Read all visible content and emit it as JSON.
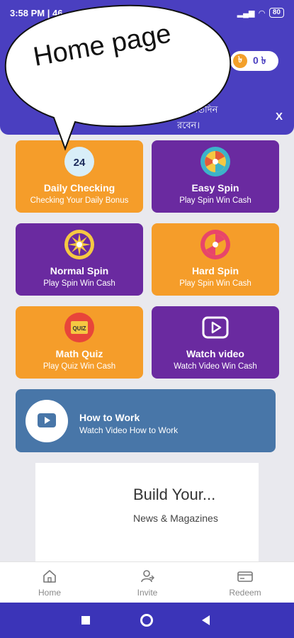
{
  "status": {
    "time": "3:58 PM | 46",
    "battery": "80"
  },
  "header": {
    "coin_symbol": "৳",
    "balance": "0 ৳",
    "marquee_line1": "ট। প্রতিদিন",
    "marquee_line2": "রবেন।",
    "close_label": "X"
  },
  "annotation": {
    "bubble_text": "Home page"
  },
  "cards": [
    {
      "title": "Daily Checking",
      "subtitle": "Checking Your Daily Bonus",
      "icon": "calendar-24-icon",
      "color": "#f59d2a"
    },
    {
      "title": "Easy Spin",
      "subtitle": "Play Spin Win Cash",
      "icon": "spin-wheel-icon",
      "color": "#6a2aa0"
    },
    {
      "title": "Normal Spin",
      "subtitle": "Play Spin Win Cash",
      "icon": "spin-wheel-icon",
      "color": "#6a2aa0"
    },
    {
      "title": "Hard Spin",
      "subtitle": "Play Spin Win Cash",
      "icon": "spin-wheel-icon",
      "color": "#f59d2a"
    },
    {
      "title": "Math Quiz",
      "subtitle": "Play Quiz Win Cash",
      "icon": "quiz-icon",
      "icon_label": "QUIZ",
      "color": "#f59d2a"
    },
    {
      "title": "Watch video",
      "subtitle": "Watch Video Win Cash",
      "icon": "video-play-icon",
      "color": "#6a2aa0"
    }
  ],
  "how_to": {
    "title": "How to Work",
    "subtitle": "Watch Video How to Work"
  },
  "ad": {
    "title": "Build Your...",
    "subtitle": "News & Magazines"
  },
  "nav": [
    {
      "label": "Home",
      "icon": "home-icon"
    },
    {
      "label": "Invite",
      "icon": "invite-icon"
    },
    {
      "label": "Redeem",
      "icon": "redeem-icon"
    }
  ],
  "colors": {
    "header": "#4a3fc0",
    "orange": "#f59d2a",
    "purple": "#6a2aa0",
    "blue_card": "#4876a8"
  }
}
